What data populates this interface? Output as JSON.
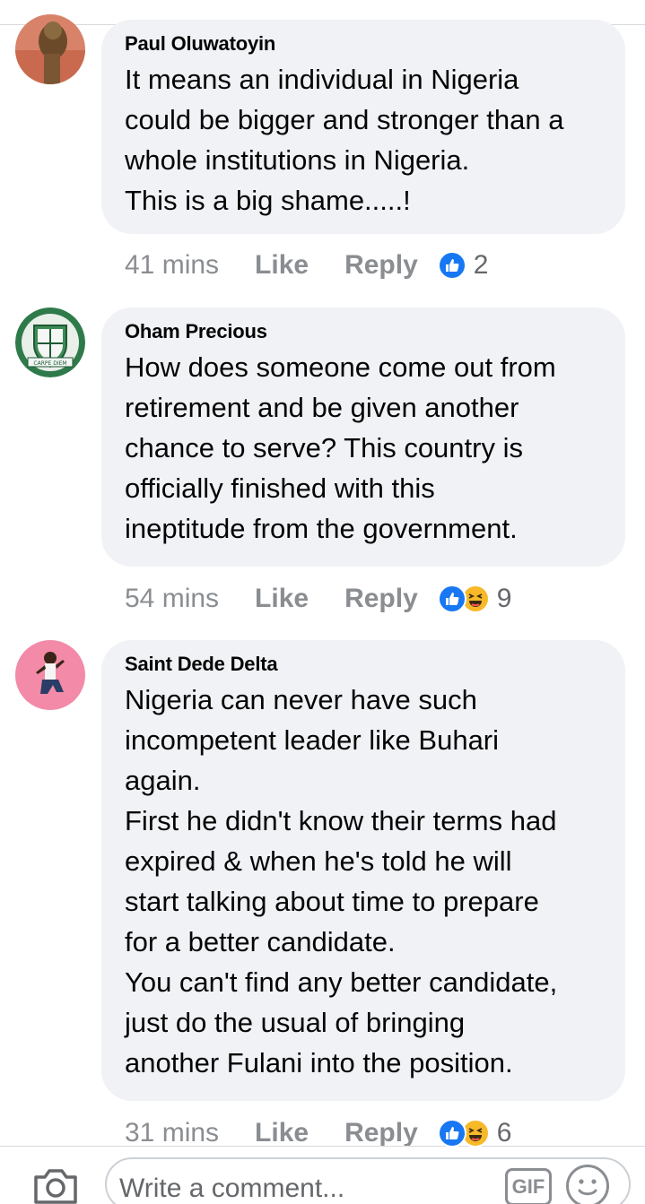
{
  "comments": [
    {
      "author": "Paul Oluwatoyin",
      "text": "It means an individual in Nigeria\ncould be bigger and stronger than a\nwhole institutions in Nigeria.\nThis is a big shame.....!",
      "time": "41 mins",
      "like_label": "Like",
      "reply_label": "Reply",
      "reactions": [
        "like"
      ],
      "reaction_count": "2"
    },
    {
      "author": "Oham Precious",
      "text": "How does someone come out from\nretirement and be given another\nchance to serve? This country is\nofficially finished with this\nineptitude from the government.",
      "time": "54 mins",
      "like_label": "Like",
      "reply_label": "Reply",
      "reactions": [
        "like",
        "haha"
      ],
      "reaction_count": "9",
      "avatar_text": "CARPE DIEM"
    },
    {
      "author": "Saint Dede Delta",
      "text": "Nigeria can never have such\nincompetent leader like Buhari\nagain.\nFirst he didn't know their terms had\nexpired & when he's told he will\nstart talking about time to prepare\nfor a better candidate.\nYou can't find any better candidate,\njust do the usual of bringing\nanother Fulani into the position.",
      "time": "31 mins",
      "like_label": "Like",
      "reply_label": "Reply",
      "reactions": [
        "like",
        "haha"
      ],
      "reaction_count": "6"
    }
  ],
  "composer": {
    "placeholder": "Write a comment...",
    "gif_label": "GIF"
  },
  "colors": {
    "bubble": "#f0f2f5",
    "like_blue": "#1877f2",
    "haha_yellow": "#f7b928",
    "meta_gray": "#8a8d91"
  }
}
